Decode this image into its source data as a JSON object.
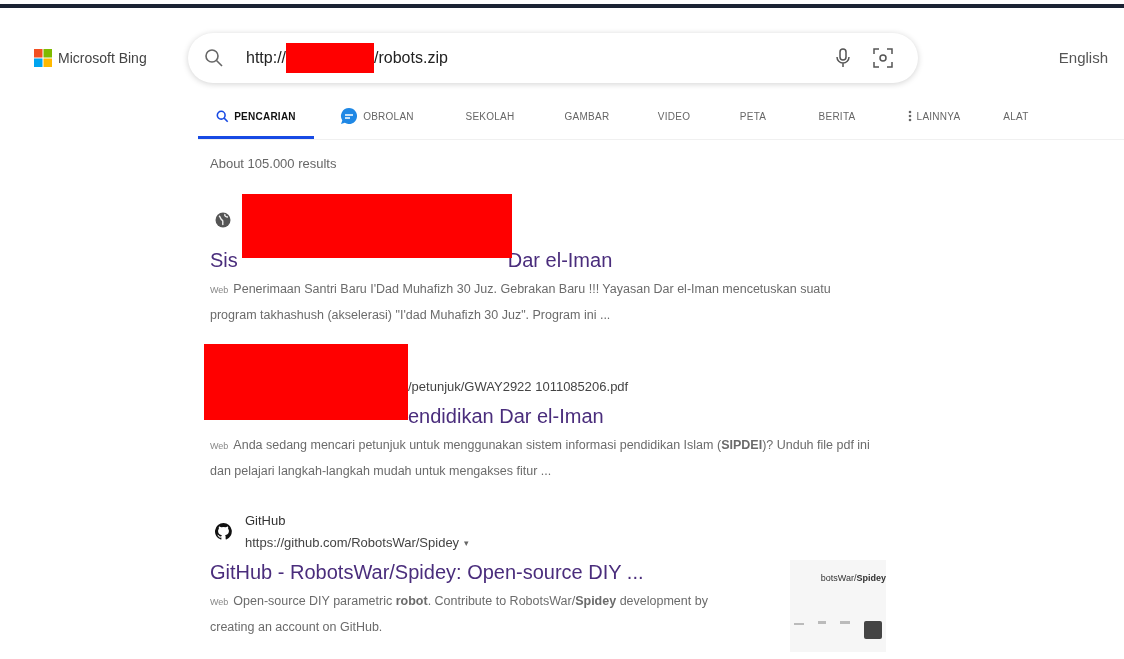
{
  "header": {
    "brand": "Microsoft Bing",
    "search": {
      "value_start": "http://",
      "value_end": "/robots.zip"
    },
    "language": "English"
  },
  "tabs": [
    {
      "label": "PENCARIAN",
      "kind": "search",
      "selected": true
    },
    {
      "label": "OBROLAN",
      "kind": "chat",
      "selected": false
    },
    {
      "label": "SEKOLAH",
      "selected": false
    },
    {
      "label": "GAMBAR",
      "selected": false
    },
    {
      "label": "VIDEO",
      "selected": false
    },
    {
      "label": "PETA",
      "selected": false
    },
    {
      "label": "BERITA",
      "selected": false
    },
    {
      "label": "LAINNYA",
      "kind": "more",
      "selected": false
    },
    {
      "label": "ALAT",
      "selected": false
    }
  ],
  "result_count": "About 105.000 results",
  "results": [
    {
      "kind": "globe",
      "title_start": "Sis",
      "title_end": "Dar el-Iman",
      "tag": "Web",
      "snippet": "Penerimaan Santri Baru I'Dad Muhafizh 30 Juz. Gebrakan Baru !!! Yayasan Dar el-Iman mencetuskan suatu program takhashush (akselerasi) \"I'dad Muhafizh 30 Juz\". Program ini ..."
    },
    {
      "url_end": "/petunjuk/GWAY2922 1011085206.pdf",
      "title_end": "endidikan Dar el-Iman",
      "tag": "Web",
      "snippet": "Anda sedang mencari petunjuk untuk menggunakan sistem informasi pendidikan Islam (**SIPDEI**)? Unduh file pdf ini dan pelajari langkah-langkah mudah untuk mengakses fitur ..."
    },
    {
      "kind": "github",
      "site": "GitHub",
      "url": "https://github.com/RobotsWar/Spidey",
      "url_caret": "▾",
      "title": "GitHub - RobotsWar/Spidey: Open-source DIY ...",
      "tag": "Web",
      "snippet": "Open-source DIY parametric **robot**. Contribute to RobotsWar/**Spidey** development by creating an account on GitHub.",
      "thumbnail_text": "botsWar/**Spidey**"
    }
  ]
}
